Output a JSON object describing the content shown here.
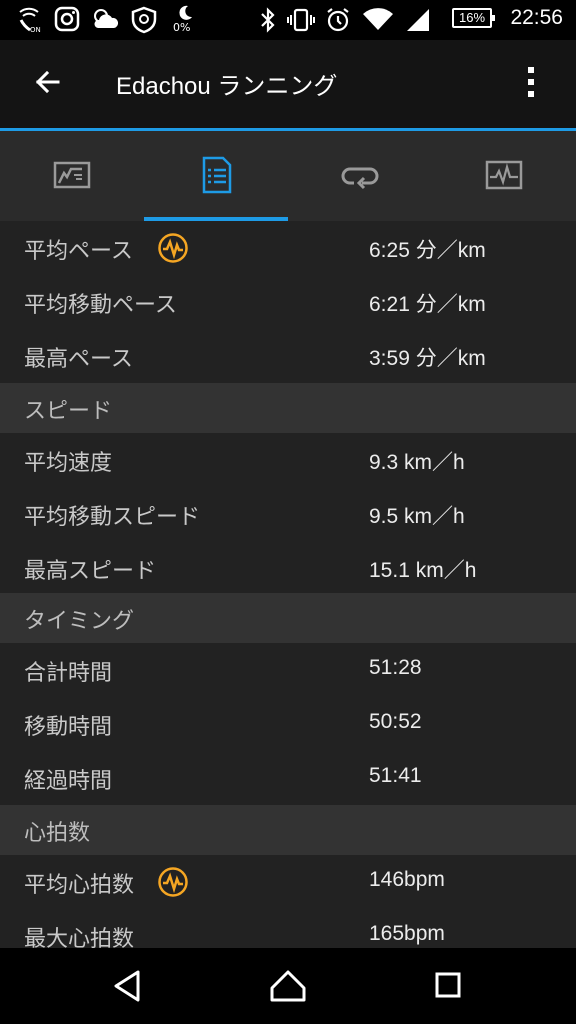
{
  "status_bar": {
    "battery": "16%",
    "time": "22:56",
    "data_saver": "0%",
    "icons": [
      "wifi-calling-icon",
      "instagram-icon",
      "weather-icon",
      "shield-app-icon",
      "moon-percent-icon",
      "bluetooth-icon",
      "vibrate-icon",
      "alarm-icon",
      "wifi-icon",
      "signal-icon",
      "battery-icon"
    ]
  },
  "app_bar": {
    "title": "Edachou ランニング",
    "back_icon": "arrow-left-icon",
    "menu_icon": "more-vertical-icon"
  },
  "tabs": [
    {
      "icon": "stats-chart-icon",
      "selected": false
    },
    {
      "icon": "details-list-icon",
      "selected": true
    },
    {
      "icon": "laps-loop-icon",
      "selected": false
    },
    {
      "icon": "graph-pulse-icon",
      "selected": false
    }
  ],
  "colors": {
    "accent": "#1e9be6",
    "hr_badge": "#f5a623"
  },
  "pace": [
    {
      "label": "平均ペース",
      "value": "6:25 分／km",
      "hr_icon": true
    },
    {
      "label": "平均移動ペース",
      "value": "6:21 分／km",
      "hr_icon": false
    },
    {
      "label": "最高ペース",
      "value": "3:59 分／km",
      "hr_icon": false
    }
  ],
  "speed_section": {
    "title": "スピード"
  },
  "speed": [
    {
      "label": "平均速度",
      "value": "9.3 km／h"
    },
    {
      "label": "平均移動スピード",
      "value": "9.5 km／h"
    },
    {
      "label": "最高スピード",
      "value": "15.1 km／h"
    }
  ],
  "timing_section": {
    "title": "タイミング"
  },
  "timing": [
    {
      "label": "合計時間",
      "value": "51:28"
    },
    {
      "label": "移動時間",
      "value": "50:52"
    },
    {
      "label": "経過時間",
      "value": "51:41"
    }
  ],
  "heart_section": {
    "title": "心拍数"
  },
  "heart": [
    {
      "label": "平均心拍数",
      "value": "146bpm",
      "hr_icon": true
    },
    {
      "label": "最大心拍数",
      "value": "165bpm",
      "hr_icon": false
    }
  ],
  "nav_bar": {
    "icons": [
      "nav-back-icon",
      "nav-home-icon",
      "nav-recents-icon"
    ]
  }
}
